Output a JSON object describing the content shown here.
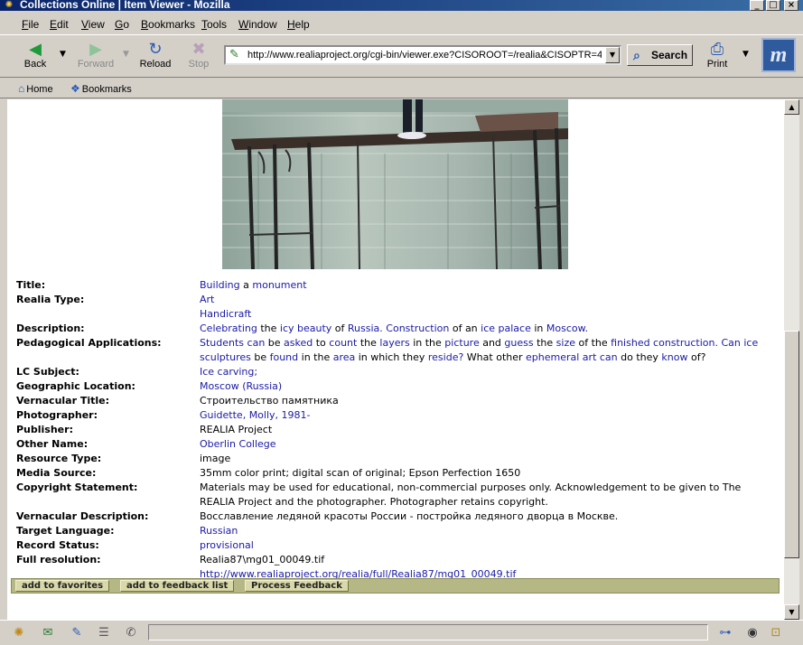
{
  "window": {
    "title": "Collections Online | Item Viewer - Mozilla",
    "controls": {
      "minimize": "_",
      "maximize": "□",
      "close": "×"
    }
  },
  "menu": [
    {
      "label": "File",
      "u": "F",
      "rest": "ile"
    },
    {
      "label": "Edit",
      "u": "E",
      "rest": "dit"
    },
    {
      "label": "View",
      "u": "V",
      "rest": "iew"
    },
    {
      "label": "Go",
      "u": "G",
      "rest": "o"
    },
    {
      "label": "Bookmarks",
      "u": "B",
      "rest": "ookmarks"
    },
    {
      "label": "Tools",
      "u": "T",
      "rest": "ools"
    },
    {
      "label": "Window",
      "u": "W",
      "rest": "indow"
    },
    {
      "label": "Help",
      "u": "H",
      "rest": "elp"
    }
  ],
  "toolbar": {
    "back": "Back",
    "forward": "Forward",
    "reload": "Reload",
    "stop": "Stop",
    "url": "http://www.realiaproject.org/cgi-bin/viewer.exe?CISOROOT=/realia&CISOPTR=4",
    "search": "Search",
    "print": "Print",
    "logo": "m"
  },
  "personal_bar": {
    "home": "Home",
    "bookmarks": "Bookmarks"
  },
  "colors": {
    "link": "#1a1aa6",
    "action_bar": "#b5b884",
    "title_bar": "#0a246a"
  },
  "record": {
    "title_label": "Title:",
    "title_words": [
      "Building",
      "a",
      "monument"
    ],
    "realia_type_label": "Realia Type:",
    "realia_type": [
      "Art",
      "Handicraft"
    ],
    "description_label": "Description:",
    "description_parts": [
      "Celebrating",
      " the ",
      "icy beauty",
      " of ",
      "Russia.",
      " ",
      "Construction",
      " of an ",
      "ice palace",
      " in ",
      "Moscow."
    ],
    "pedagogical_label": "Pedagogical Applications:",
    "pedagogical_parts": [
      "Students can",
      " be ",
      "asked",
      " to ",
      "count",
      " the ",
      "layers",
      " in the ",
      "picture",
      " and ",
      "guess",
      " the ",
      "size",
      " of the ",
      "finished construction.",
      " ",
      "Can ice sculptures",
      " be ",
      "found",
      " in the ",
      "area",
      " in which they ",
      "reside?",
      " What other ",
      "ephemeral art can",
      " do they ",
      "know",
      " of?"
    ],
    "lc_subject_label": "LC Subject:",
    "lc_subject": "Ice carving;",
    "geo_label": "Geographic Location:",
    "geo": "Moscow (Russia)",
    "vern_title_label": "Vernacular Title:",
    "vern_title": "Строительство памятника",
    "photographer_label": "Photographer:",
    "photographer": "Guidette, Molly, 1981-",
    "publisher_label": "Publisher:",
    "publisher": "REALIA Project",
    "other_name_label": "Other Name:",
    "other_name": "Oberlin College",
    "resource_type_label": "Resource Type:",
    "resource_type": "image",
    "media_source_label": "Media Source:",
    "media_source": "35mm color print; digital scan of original; Epson Perfection 1650",
    "copyright_label": "Copyright Statement:",
    "copyright": "Materials may be used for educational, non-commercial purposes only. Acknowledgement to be given to The REALIA Project and the photographer. Photographer retains copyright.",
    "vern_desc_label": "Vernacular Description:",
    "vern_desc": "Восславление ледяной красоты России - постройка ледяного дворца в Москве.",
    "target_lang_label": "Target Language:",
    "target_lang": "Russian",
    "record_status_label": "Record Status:",
    "record_status": "provisional",
    "full_res_label": "Full resolution:",
    "full_res_file": "Realia87\\mg01_00049.tif",
    "full_res_url": "http://www.realiaproject.org/realia/full/Realia87/mg01_00049.tif"
  },
  "actions": {
    "favorites": "add to favorites",
    "feedback_list": "add to feedback list",
    "process_feedback": "Process Feedback"
  }
}
